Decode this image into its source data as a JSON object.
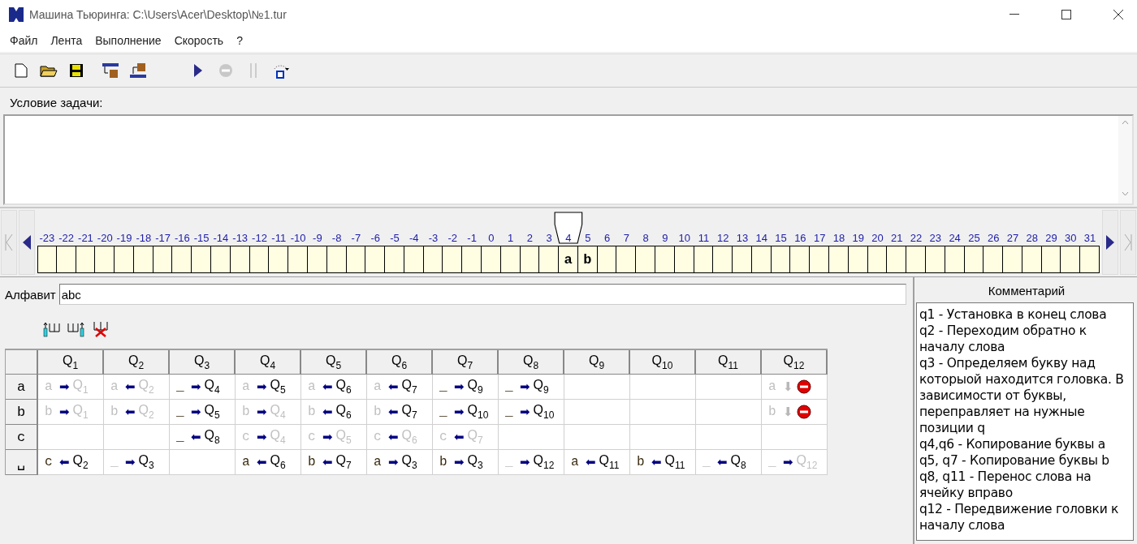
{
  "window": {
    "title": "Машина Тьюринга: C:\\Users\\Acer\\Desktop\\№1.tur"
  },
  "menu": [
    "Файл",
    "Лента",
    "Выполнение",
    "Скорость",
    "?"
  ],
  "task": {
    "label": "Условие задачи:"
  },
  "tape": {
    "cells": [
      {
        "index": "-23",
        "head": false
      },
      {
        "index": "-22",
        "head": false
      },
      {
        "index": "-21",
        "head": false
      },
      {
        "index": "-20",
        "head": false
      },
      {
        "index": "-19",
        "head": false
      },
      {
        "index": "-18",
        "head": false
      },
      {
        "index": "-17",
        "head": false
      },
      {
        "index": "-16",
        "head": false
      },
      {
        "index": "-15",
        "head": false
      },
      {
        "index": "-14",
        "head": false
      },
      {
        "index": "-13",
        "head": false
      },
      {
        "index": "-12",
        "head": false
      },
      {
        "index": "-11",
        "head": false
      },
      {
        "index": "-10",
        "head": false
      },
      {
        "index": "-9",
        "head": false
      },
      {
        "index": "-8",
        "head": false
      },
      {
        "index": "-7",
        "head": false
      },
      {
        "index": "-6",
        "head": false
      },
      {
        "index": "-5",
        "head": false
      },
      {
        "index": "-4",
        "head": false
      },
      {
        "index": "-3",
        "head": false
      },
      {
        "index": "-2",
        "head": false
      },
      {
        "index": "-1",
        "head": false
      },
      {
        "index": "0",
        "head": false
      },
      {
        "index": "1",
        "head": false
      },
      {
        "index": "2",
        "head": false
      },
      {
        "index": "3",
        "head": false
      },
      {
        "index": "4",
        "head": true,
        "symbol": "a"
      },
      {
        "index": "5",
        "head": false,
        "symbol": "b"
      },
      {
        "index": "6",
        "head": false
      },
      {
        "index": "7",
        "head": false
      },
      {
        "index": "8",
        "head": false
      },
      {
        "index": "9",
        "head": false
      },
      {
        "index": "10",
        "head": false
      },
      {
        "index": "11",
        "head": false
      },
      {
        "index": "12",
        "head": false
      },
      {
        "index": "13",
        "head": false
      },
      {
        "index": "14",
        "head": false
      },
      {
        "index": "15",
        "head": false
      },
      {
        "index": "16",
        "head": false
      },
      {
        "index": "17",
        "head": false
      },
      {
        "index": "18",
        "head": false
      },
      {
        "index": "19",
        "head": false
      },
      {
        "index": "20",
        "head": false
      },
      {
        "index": "21",
        "head": false
      },
      {
        "index": "22",
        "head": false
      },
      {
        "index": "23",
        "head": false
      },
      {
        "index": "24",
        "head": false
      },
      {
        "index": "25",
        "head": false
      },
      {
        "index": "26",
        "head": false
      },
      {
        "index": "27",
        "head": false
      },
      {
        "index": "28",
        "head": false
      },
      {
        "index": "29",
        "head": false
      },
      {
        "index": "30",
        "head": false
      },
      {
        "index": "31",
        "head": false
      }
    ]
  },
  "alphabet": {
    "label": "Алфавит",
    "value": "abc"
  },
  "table": {
    "columns": [
      "Q$_{1}$",
      "Q$_{2}$",
      "Q$_{3}$",
      "Q$_{4}$",
      "Q$_{5}$",
      "Q$_{6}$",
      "Q$_{7}$",
      "Q$_{8}$",
      "Q$_{9}$",
      "Q$_{10}$",
      "Q$_{11}$",
      "Q$_{12}$"
    ],
    "rows": [
      {
        "symbol": "a",
        "cells": [
          {
            "kind": "rule",
            "symbol": "a",
            "symbol_same": true,
            "arrow": "➡",
            "state": "Q$_{1}$",
            "state_same": true
          },
          {
            "kind": "rule",
            "symbol": "a",
            "symbol_same": true,
            "arrow": "⬅",
            "state": "Q$_{2}$",
            "state_same": true
          },
          {
            "kind": "rule",
            "symbol": "_",
            "symbol_same": false,
            "arrow": "➡",
            "state": "Q$_{4}$",
            "state_same": false
          },
          {
            "kind": "rule",
            "symbol": "a",
            "symbol_same": true,
            "arrow": "➡",
            "state": "Q$_{5}$",
            "state_same": false
          },
          {
            "kind": "rule",
            "symbol": "a",
            "symbol_same": true,
            "arrow": "⬅",
            "state": "Q$_{6}$",
            "state_same": false
          },
          {
            "kind": "rule",
            "symbol": "a",
            "symbol_same": true,
            "arrow": "⬅",
            "state": "Q$_{7}$",
            "state_same": false
          },
          {
            "kind": "rule",
            "symbol": "_",
            "symbol_same": false,
            "arrow": "➡",
            "state": "Q$_{9}$",
            "state_same": false
          },
          {
            "kind": "rule",
            "symbol": "_",
            "symbol_same": false,
            "arrow": "➡",
            "state": "Q$_{9}$",
            "state_same": false
          },
          {
            "kind": "empty"
          },
          {
            "kind": "empty"
          },
          {
            "kind": "empty"
          },
          {
            "kind": "halt",
            "symbol": "a",
            "symbol_same": true,
            "arrow": "⬇"
          }
        ]
      },
      {
        "symbol": "b",
        "cells": [
          {
            "kind": "rule",
            "symbol": "b",
            "symbol_same": true,
            "arrow": "➡",
            "state": "Q$_{1}$",
            "state_same": true
          },
          {
            "kind": "rule",
            "symbol": "b",
            "symbol_same": true,
            "arrow": "⬅",
            "state": "Q$_{2}$",
            "state_same": true
          },
          {
            "kind": "rule",
            "symbol": "_",
            "symbol_same": false,
            "arrow": "➡",
            "state": "Q$_{5}$",
            "state_same": false
          },
          {
            "kind": "rule",
            "symbol": "b",
            "symbol_same": true,
            "arrow": "➡",
            "state": "Q$_{4}$",
            "state_same": true
          },
          {
            "kind": "rule",
            "symbol": "b",
            "symbol_same": true,
            "arrow": "⬅",
            "state": "Q$_{6}$",
            "state_same": false
          },
          {
            "kind": "rule",
            "symbol": "b",
            "symbol_same": true,
            "arrow": "⬅",
            "state": "Q$_{7}$",
            "state_same": false
          },
          {
            "kind": "rule",
            "symbol": "_",
            "symbol_same": false,
            "arrow": "➡",
            "state": "Q$_{10}$",
            "state_same": false
          },
          {
            "kind": "rule",
            "symbol": "_",
            "symbol_same": false,
            "arrow": "➡",
            "state": "Q$_{10}$",
            "state_same": false
          },
          {
            "kind": "empty"
          },
          {
            "kind": "empty"
          },
          {
            "kind": "empty"
          },
          {
            "kind": "halt",
            "symbol": "b",
            "symbol_same": true,
            "arrow": "⬇"
          }
        ]
      },
      {
        "symbol": "c",
        "cells": [
          {
            "kind": "empty"
          },
          {
            "kind": "empty"
          },
          {
            "kind": "rule",
            "symbol": "_",
            "symbol_same": false,
            "arrow": "⬅",
            "state": "Q$_{8}$",
            "state_same": false
          },
          {
            "kind": "rule",
            "symbol": "c",
            "symbol_same": true,
            "arrow": "➡",
            "state": "Q$_{4}$",
            "state_same": true
          },
          {
            "kind": "rule",
            "symbol": "c",
            "symbol_same": true,
            "arrow": "➡",
            "state": "Q$_{5}$",
            "state_same": true
          },
          {
            "kind": "rule",
            "symbol": "c",
            "symbol_same": true,
            "arrow": "⬅",
            "state": "Q$_{6}$",
            "state_same": true
          },
          {
            "kind": "rule",
            "symbol": "c",
            "symbol_same": true,
            "arrow": "⬅",
            "state": "Q$_{7}$",
            "state_same": true
          },
          {
            "kind": "empty"
          },
          {
            "kind": "empty"
          },
          {
            "kind": "empty"
          },
          {
            "kind": "empty"
          },
          {
            "kind": "empty"
          }
        ]
      },
      {
        "symbol": "␣",
        "cells": [
          {
            "kind": "rule",
            "symbol": "c",
            "symbol_same": false,
            "arrow": "⬅",
            "state": "Q$_{2}$",
            "state_same": false
          },
          {
            "kind": "rule",
            "symbol": "_",
            "symbol_same": true,
            "arrow": "➡",
            "state": "Q$_{3}$",
            "state_same": false
          },
          {
            "kind": "empty"
          },
          {
            "kind": "rule",
            "symbol": "a",
            "symbol_same": false,
            "arrow": "⬅",
            "state": "Q$_{6}$",
            "state_same": false
          },
          {
            "kind": "rule",
            "symbol": "b",
            "symbol_same": false,
            "arrow": "⬅",
            "state": "Q$_{7}$",
            "state_same": false
          },
          {
            "kind": "rule",
            "symbol": "a",
            "symbol_same": false,
            "arrow": "➡",
            "state": "Q$_{3}$",
            "state_same": false
          },
          {
            "kind": "rule",
            "symbol": "b",
            "symbol_same": false,
            "arrow": "➡",
            "state": "Q$_{3}$",
            "state_same": false
          },
          {
            "kind": "rule",
            "symbol": "_",
            "symbol_same": true,
            "arrow": "➡",
            "state": "Q$_{12}$",
            "state_same": false
          },
          {
            "kind": "rule",
            "symbol": "a",
            "symbol_same": false,
            "arrow": "⬅",
            "state": "Q$_{11}$",
            "state_same": false
          },
          {
            "kind": "rule",
            "symbol": "b",
            "symbol_same": false,
            "arrow": "⬅",
            "state": "Q$_{11}$",
            "state_same": false
          },
          {
            "kind": "rule",
            "symbol": "_",
            "symbol_same": true,
            "arrow": "⬅",
            "state": "Q$_{8}$",
            "state_same": false
          },
          {
            "kind": "rule",
            "symbol": "_",
            "symbol_same": true,
            "arrow": "➡",
            "state": "Q$_{12}$",
            "state_same": true
          }
        ]
      }
    ]
  },
  "comment": {
    "title": "Комментарий",
    "lines": [
      "q1 - Установка в конец слова",
      "q2 - Переходим обратно к началу слова",
      "q3 - Определяем букву над которыой находится головка. В зависимости от буквы, переправляет на нужные позиции q",
      "q4,q6 - Копирование буквы a",
      "q5, q7 - Копирование буквы b",
      "q8, q11 - Перенос слова на ячейку вправо",
      "q12 - Передвижение головки к началу слова"
    ]
  }
}
